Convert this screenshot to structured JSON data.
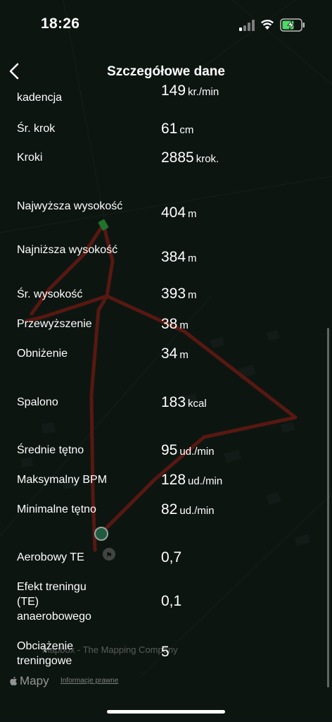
{
  "status": {
    "time": "18:26"
  },
  "nav": {
    "title": "Szczegółowe dane"
  },
  "stats": [
    {
      "label": "kadencja",
      "value": "149",
      "unit": "kr./min"
    },
    {
      "label": "Śr. krok",
      "value": "61",
      "unit": "cm"
    },
    {
      "label": "Kroki",
      "value": "2885",
      "unit": "krok."
    },
    {
      "label": "Najwyższa wysokość",
      "value": "404",
      "unit": "m"
    },
    {
      "label": "Najniższa wysokość",
      "value": "384",
      "unit": "m"
    },
    {
      "label": "Śr. wysokość",
      "value": "393",
      "unit": "m"
    },
    {
      "label": "Przewyższenie",
      "value": "38",
      "unit": "m"
    },
    {
      "label": "Obniżenie",
      "value": "34",
      "unit": "m"
    },
    {
      "label": "Spalono",
      "value": "183",
      "unit": "kcal"
    },
    {
      "label": "Średnie tętno",
      "value": "95",
      "unit": "ud./min"
    },
    {
      "label": "Maksymalny BPM",
      "value": "128",
      "unit": "ud./min"
    },
    {
      "label": "Minimalne tętno",
      "value": "82",
      "unit": "ud./min"
    },
    {
      "label": "Aerobowy TE",
      "value": "0,7",
      "unit": ""
    },
    {
      "label": "Efekt treningu (TE) anaerobowego",
      "value": "0,1",
      "unit": ""
    },
    {
      "label": "Obciążenie treningowe",
      "value": "5",
      "unit": ""
    }
  ],
  "map": {
    "brand": "Mapy",
    "legal": "Informacje prawne",
    "attribution": "Mapbox - The Mapping Company",
    "route_color": "#7a1f16",
    "start_color": "#2e7d5b"
  }
}
